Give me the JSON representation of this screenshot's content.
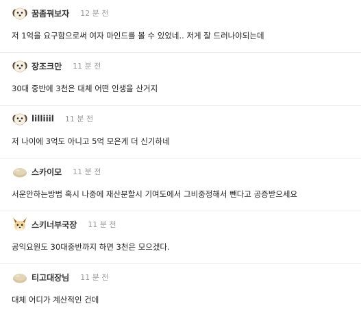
{
  "comments": [
    {
      "avatar_icon": "puppy-icon",
      "nickname": "꿈좀꿔보자",
      "time": "12 분 전",
      "text": "저 1억을 요구함으로써 여자 마인드를 볼 수 있었네.. 저게 잘 드러나야되는데"
    },
    {
      "avatar_icon": "puppy-icon",
      "nickname": "장조크만",
      "time": "11 분 전",
      "text": "30대 중반에 3천은 대체 어떤 인생을 산거지"
    },
    {
      "avatar_icon": "puppy-icon",
      "nickname": "lilliiil",
      "time": "11 분 전",
      "text": "저 나이에 3억도 아니고 5억 모은게 더 신기하네"
    },
    {
      "avatar_icon": "bean-icon",
      "nickname": "스카이모",
      "time": "11 분 전",
      "text": "서운안하는방법 혹시 나중에 재산분할시 기여도에서 그비중정해서 뺀다고 공증받으세요"
    },
    {
      "avatar_icon": "fox-icon",
      "nickname": "스키너부국장",
      "time": "11 분 전",
      "text": "공익요원도 30대중반까지 하면 3천은 모으겠다."
    },
    {
      "avatar_icon": "bean-icon",
      "nickname": "티고대장님",
      "time": "11 분 전",
      "text": "대체 어디가 계산적인 건데"
    }
  ]
}
